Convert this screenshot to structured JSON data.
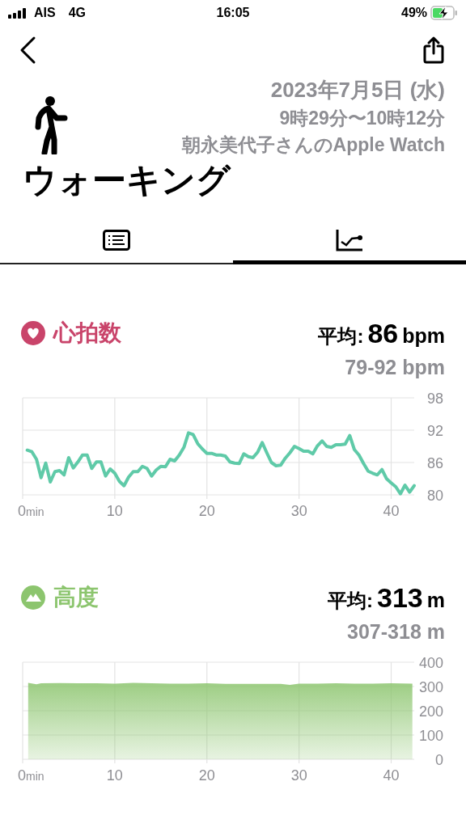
{
  "status_bar": {
    "carrier": "AIS",
    "network": "4G",
    "time": "16:05",
    "battery": "49%"
  },
  "header": {
    "date": "2023年7月5日 (水)",
    "time_range": "9時29分〜10時12分",
    "device": "朝永美代子さんのApple Watch",
    "title": "ウォーキング"
  },
  "tabs": [
    {
      "kind": "list",
      "selected": false
    },
    {
      "kind": "chart",
      "selected": true
    }
  ],
  "sections": [
    {
      "kind": "heart_rate",
      "title": "心拍数",
      "color": "#c9446a",
      "avg_label": "平均:",
      "avg_value": "86",
      "unit": "bpm",
      "range": "79-92 bpm",
      "chart_data": {
        "type": "line",
        "x": [
          0.5,
          1,
          1.5,
          2,
          2.5,
          3,
          3.5,
          4,
          4.5,
          5,
          5.5,
          6,
          6.5,
          7,
          7.5,
          8,
          8.5,
          9,
          9.5,
          10,
          10.5,
          11,
          11.5,
          12,
          12.5,
          13,
          13.5,
          14,
          14.5,
          15,
          15.5,
          16,
          16.5,
          17,
          17.5,
          18,
          18.5,
          19,
          19.5,
          20,
          20.5,
          21,
          21.5,
          22,
          22.5,
          23,
          23.5,
          24,
          24.5,
          25,
          25.5,
          26,
          26.5,
          27,
          27.5,
          28,
          28.5,
          29,
          29.5,
          30,
          30.5,
          31,
          31.5,
          32,
          32.5,
          33,
          33.5,
          34,
          34.5,
          35,
          35.5,
          36,
          36.5,
          37,
          37.5,
          38,
          38.5,
          39,
          39.5,
          40,
          40.5,
          41,
          41.5,
          42,
          42.5
        ],
        "grid": true,
        "series": [
          {
            "color": "#5fcaa8",
            "values": [
              88.3,
              88.0,
              86.6,
              83.2,
              85.9,
              82.4,
              84.3,
              84.5,
              83.7,
              86.9,
              85.0,
              86.1,
              87.4,
              87.4,
              84.9,
              86.1,
              86.1,
              83.5,
              84.8,
              84.0,
              82.5,
              81.7,
              83.3,
              84.3,
              84.3,
              85.3,
              84.9,
              83.5,
              84.6,
              85.3,
              85.2,
              86.6,
              86.3,
              87.4,
              88.8,
              91.5,
              91.2,
              89.5,
              88.5,
              87.7,
              87.7,
              87.4,
              87.4,
              87.2,
              86.1,
              85.9,
              85.8,
              87.6,
              87.1,
              86.9,
              87.9,
              89.7,
              87.8,
              86.0,
              85.4,
              85.5,
              86.8,
              87.8,
              89.0,
              88.6,
              88.1,
              88.1,
              87.6,
              89.1,
              90.0,
              89.0,
              88.8,
              89.3,
              89.3,
              89.4,
              91.0,
              88.4,
              87.4,
              85.8,
              84.4,
              84.0,
              83.7,
              84.7,
              83.0,
              82.2,
              81.5,
              80.2,
              81.8,
              80.5,
              81.7
            ]
          }
        ],
        "xlim": [
          0,
          42.5
        ],
        "ylim": [
          80,
          98
        ],
        "xticks": [
          {
            "value": 0,
            "label": "0min"
          },
          10,
          20,
          30,
          40
        ],
        "yticks": [
          80,
          86,
          92,
          98
        ]
      }
    },
    {
      "kind": "altitude",
      "title": "高度",
      "color": "#8cc56e",
      "avg_label": "平均:",
      "avg_value": "313",
      "unit": "m",
      "range": "307-318 m",
      "chart_data": {
        "type": "area",
        "x": [
          0.6,
          1.5,
          2,
          4,
          6,
          8,
          10,
          12,
          14,
          16,
          18,
          20,
          22,
          24,
          26,
          28,
          29,
          30,
          32,
          34,
          36,
          38,
          40,
          42.3
        ],
        "grid": true,
        "series": [
          {
            "color": "#8cc56e",
            "values": [
              315,
              309,
              313,
              314,
              313,
              313,
              312,
              315,
              313,
              312,
              312,
              313,
              311,
              311,
              311,
              311,
              307,
              312,
              312,
              313,
              312,
              312,
              313,
              312
            ]
          }
        ],
        "xlim": [
          0,
          42.5
        ],
        "ylim": [
          0,
          400
        ],
        "xticks": [
          {
            "value": 0,
            "label": "0min"
          },
          10,
          20,
          30,
          40
        ],
        "yticks": [
          0,
          100,
          200,
          300,
          400
        ]
      }
    }
  ]
}
